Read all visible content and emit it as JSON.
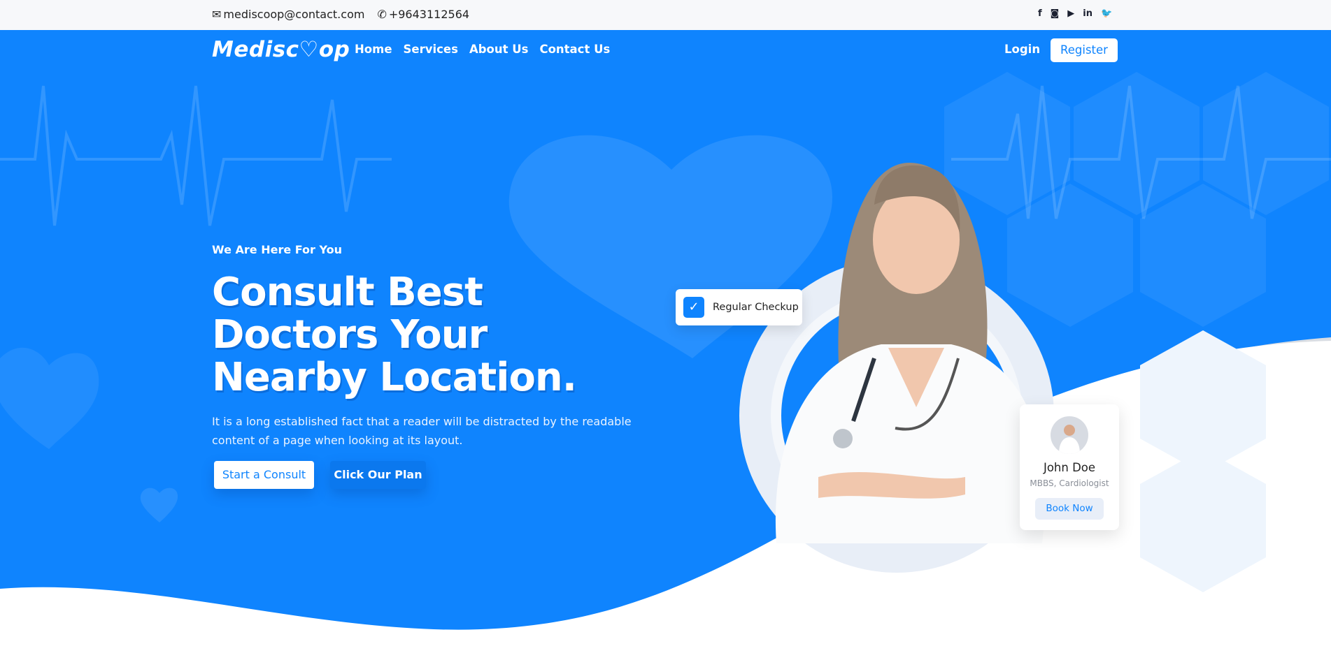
{
  "topbar": {
    "email": "mediscoop@contact.com",
    "phone": "+9643112564",
    "social": [
      "facebook-icon",
      "instagram-icon",
      "youtube-icon",
      "linkedin-icon",
      "twitter-icon"
    ]
  },
  "nav": {
    "logo": "Mediscoop",
    "logo_pre": "Medisc",
    "logo_post": "op",
    "items": [
      "Home",
      "Services",
      "About Us",
      "Contact Us"
    ],
    "login": "Login",
    "register": "Register"
  },
  "hero": {
    "tagline": "We Are Here For You",
    "headline": [
      "Consult Best",
      "Doctors Your",
      "Nearby Location."
    ],
    "description": [
      "It is a long established fact that a reader will be distracted by the readable",
      "content of a page when looking at its layout."
    ],
    "primary_button": "Start a Consult",
    "secondary_button": "Click Our Plan"
  },
  "checkup_card": {
    "label": "Regular Checkup"
  },
  "doctor_card": {
    "name": "John Doe",
    "specialty": "MBBS, Cardiologist",
    "button": "Book Now"
  },
  "colors": {
    "primary": "#0f84fe",
    "topbar": "#f7f8fa"
  }
}
